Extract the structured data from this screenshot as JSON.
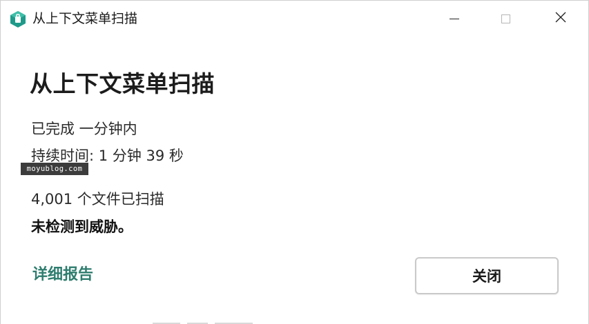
{
  "window": {
    "title": "从上下文菜单扫描",
    "controls": {
      "minimize": "minimize-icon",
      "maximize": "maximize-icon",
      "close": "close-icon"
    }
  },
  "main": {
    "heading": "从上下文菜单扫描",
    "completed": "已完成 一分钟内",
    "duration": "持续时间: 1 分钟 39 秒",
    "files_scanned": "4,001 个文件已扫描",
    "result": "未检测到威胁。"
  },
  "watermark": "moyublog.com",
  "footer": {
    "details_link": "详细报告",
    "close_button": "关闭"
  },
  "colors": {
    "link": "#2e7d6e",
    "app_icon_primary": "#1f9a8a",
    "app_icon_secondary": "#3fbfa8"
  }
}
